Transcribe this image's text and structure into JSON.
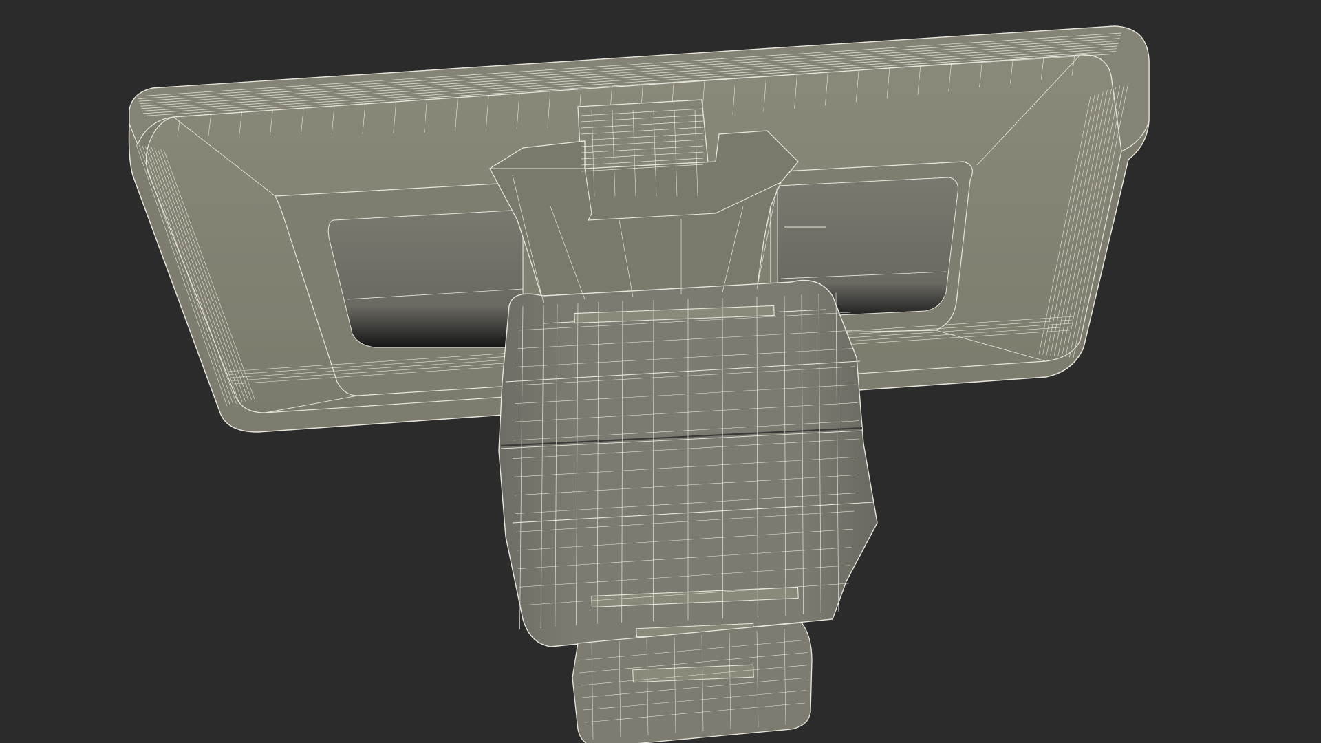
{
  "scene": {
    "subject": "wireframe-3d-model",
    "view": "bottom-perspective",
    "shading": "solid-with-wire-overlay"
  },
  "colors": {
    "background": "#2b2b2b",
    "surface": "#7d7b70",
    "surface_light": "#8a8879",
    "surface_dark": "#5f5e57",
    "recess": "#6f6e66",
    "recess_shadow": "#1a1a1a",
    "wire": "#e8e6dc"
  }
}
